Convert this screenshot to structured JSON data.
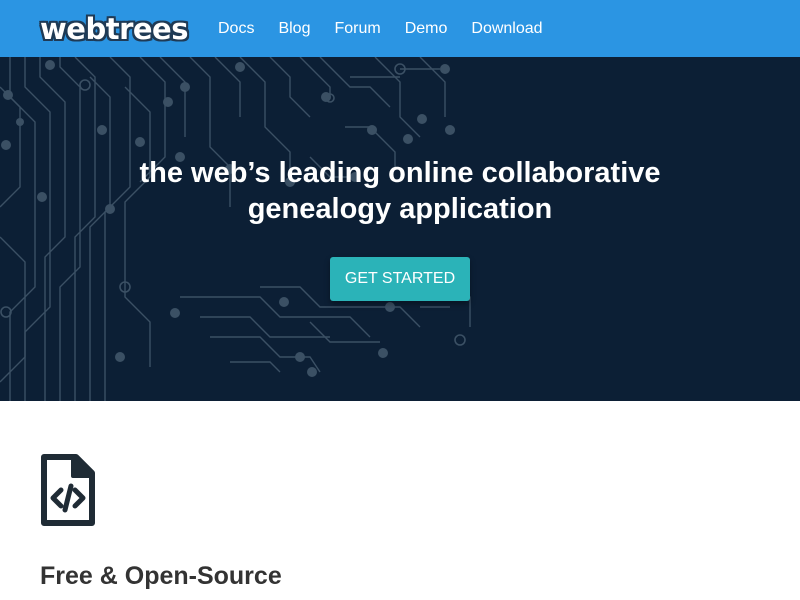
{
  "brand": {
    "name": "webtrees"
  },
  "nav": {
    "items": [
      {
        "label": "Docs"
      },
      {
        "label": "Blog"
      },
      {
        "label": "Forum"
      },
      {
        "label": "Demo"
      },
      {
        "label": "Download"
      }
    ]
  },
  "hero": {
    "title_line1": "the web’s leading online collaborative",
    "title_line2": "genealogy application",
    "cta_label": "GET STARTED"
  },
  "features": [
    {
      "title": "Free & Open-Source",
      "icon": "file-code-icon"
    }
  ],
  "colors": {
    "navbar": "#2b95e3",
    "hero_bg": "#0c1f35",
    "circuit": "#3b5064",
    "cta": "#2bb3b8"
  }
}
